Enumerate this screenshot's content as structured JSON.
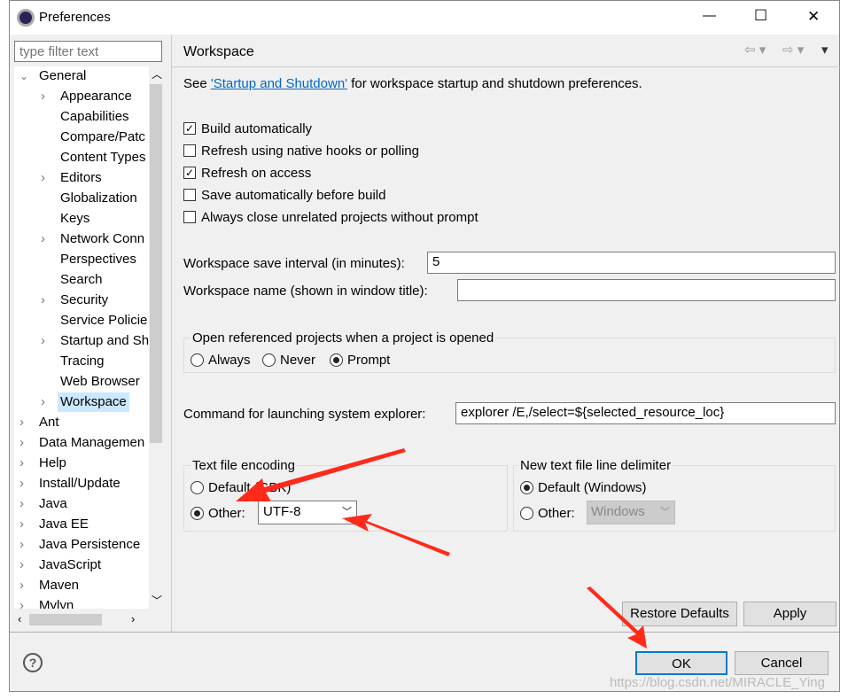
{
  "window": {
    "title": "Preferences",
    "minimize": "—",
    "maximize": "☐",
    "close": "✕"
  },
  "filter": {
    "placeholder": "type filter text"
  },
  "tree": [
    {
      "label": "General",
      "level": 0,
      "expanded": true
    },
    {
      "label": "Appearance",
      "level": 1,
      "has_children": true
    },
    {
      "label": "Capabilities",
      "level": 1
    },
    {
      "label": "Compare/Patc",
      "level": 1
    },
    {
      "label": "Content Types",
      "level": 1
    },
    {
      "label": "Editors",
      "level": 1,
      "has_children": true
    },
    {
      "label": "Globalization",
      "level": 1
    },
    {
      "label": "Keys",
      "level": 1
    },
    {
      "label": "Network Conn",
      "level": 1,
      "has_children": true
    },
    {
      "label": "Perspectives",
      "level": 1
    },
    {
      "label": "Search",
      "level": 1
    },
    {
      "label": "Security",
      "level": 1,
      "has_children": true
    },
    {
      "label": "Service Policie",
      "level": 1
    },
    {
      "label": "Startup and Sh",
      "level": 1,
      "has_children": true
    },
    {
      "label": "Tracing",
      "level": 1
    },
    {
      "label": "Web Browser",
      "level": 1
    },
    {
      "label": "Workspace",
      "level": 1,
      "has_children": true,
      "selected": true
    },
    {
      "label": "Ant",
      "level": 0,
      "has_children": true
    },
    {
      "label": "Data Managemen",
      "level": 0,
      "has_children": true
    },
    {
      "label": "Help",
      "level": 0,
      "has_children": true
    },
    {
      "label": "Install/Update",
      "level": 0,
      "has_children": true
    },
    {
      "label": "Java",
      "level": 0,
      "has_children": true
    },
    {
      "label": "Java EE",
      "level": 0,
      "has_children": true
    },
    {
      "label": "Java Persistence",
      "level": 0,
      "has_children": true
    },
    {
      "label": "JavaScript",
      "level": 0,
      "has_children": true
    },
    {
      "label": "Maven",
      "level": 0,
      "has_children": true
    },
    {
      "label": "Mylyn",
      "level": 0,
      "has_children": true
    }
  ],
  "page": {
    "title": "Workspace",
    "see_prefix": "See ",
    "see_link": "'Startup and Shutdown'",
    "see_suffix": " for workspace startup and shutdown preferences.",
    "checkboxes": [
      {
        "label": "Build automatically",
        "checked": true
      },
      {
        "label": "Refresh using native hooks or polling",
        "checked": false
      },
      {
        "label": "Refresh on access",
        "checked": true
      },
      {
        "label": "Save automatically before build",
        "checked": false
      },
      {
        "label": "Always close unrelated projects without prompt",
        "checked": false
      }
    ],
    "save_interval_label": "Workspace save interval (in minutes):",
    "save_interval_value": "5",
    "ws_name_label": "Workspace name (shown in window title):",
    "ws_name_value": "",
    "open_ref_label": "Open referenced projects when a project is opened",
    "open_ref_options": [
      "Always",
      "Never",
      "Prompt"
    ],
    "open_ref_selected": "Prompt",
    "explorer_label": "Command for launching system explorer:",
    "explorer_value": "explorer /E,/select=${selected_resource_loc}",
    "encoding": {
      "label": "Text file encoding",
      "default_label": "Default (GBK)",
      "other_label": "Other:",
      "other_value": "UTF-8",
      "selected": "Other"
    },
    "delimiter": {
      "label": "New text file line delimiter",
      "default_label": "Default (Windows)",
      "other_label": "Other:",
      "other_value": "Windows",
      "selected": "Default"
    },
    "restore_defaults": "Restore Defaults",
    "apply": "Apply"
  },
  "footer": {
    "help": "?",
    "ok": "OK",
    "cancel": "Cancel"
  },
  "watermark": "https://blog.csdn.net/MIRACLE_Ying",
  "colors": {
    "accent": "#0078d7",
    "link": "#0066cc",
    "annotation": "#ff2a1a",
    "selection": "#cce8ff"
  }
}
